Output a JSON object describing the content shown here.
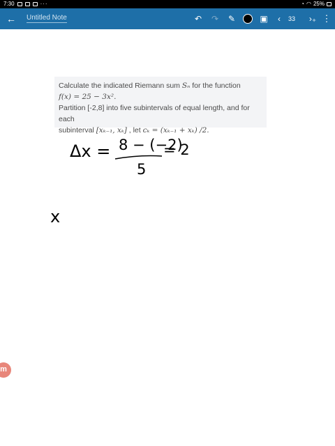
{
  "status_bar": {
    "time": "7:30",
    "battery": "25%",
    "overflow": "···"
  },
  "toolbar": {
    "back_icon": "arrow-left-icon",
    "title": "Untitled Note",
    "page_number": "33"
  },
  "problem": {
    "line1_prefix": "Calculate the indicated Riemann sum ",
    "line1_math": "Sₙ",
    "line1_suffix": " for the function",
    "line2_math": "f(x) = 25 − 3x².",
    "line3": "Partition [-2,8] into five subintervals of equal length, and for each",
    "line4_prefix": "subinterval ",
    "line4_math1": "[xₖ₋₁, xₖ]",
    "line4_mid": " , let ",
    "line4_math2": "cₖ = (xₖ₋₁ + xₖ) /2."
  },
  "handwriting": {
    "delta_x_lhs": "Δx =",
    "numerator": "8 − (−2)",
    "denominator": "5",
    "result": "= 2",
    "x_mark": "x"
  },
  "badge": {
    "letter": "m"
  },
  "colors": {
    "toolbar": "#1e6fa8",
    "status_bar": "#000000",
    "problem_bg": "#f3f4f6",
    "badge": "#e8867a"
  }
}
